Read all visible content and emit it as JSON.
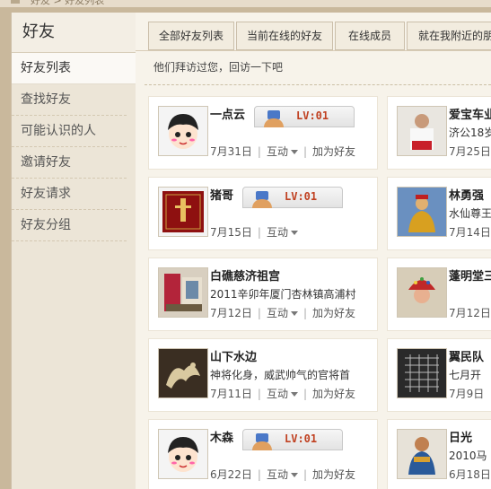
{
  "breadcrumb": "好友 > 好友列表",
  "sidebar": {
    "title": "好友",
    "items": [
      {
        "label": "好友列表",
        "active": true
      },
      {
        "label": "查找好友"
      },
      {
        "label": "可能认识的人"
      },
      {
        "label": "邀请好友"
      },
      {
        "label": "好友请求"
      },
      {
        "label": "好友分组"
      }
    ]
  },
  "tabs": [
    {
      "label": "全部好友列表"
    },
    {
      "label": "当前在线的好友"
    },
    {
      "label": "在线成员"
    },
    {
      "label": "就在我附近的朋友"
    }
  ],
  "notice": "他们拜访过您，回访一下吧",
  "interact_label": "互动",
  "add_friend_label": "加为好友",
  "badge_text": "LV:01",
  "left_cards": [
    {
      "name": "一点云",
      "signature": "",
      "date": "7月31日",
      "add": true,
      "badge": true
    },
    {
      "name": "猪哥",
      "signature": "",
      "date": "7月15日",
      "add": false,
      "badge": true
    },
    {
      "name": "白礁慈济祖宫",
      "signature": "2011辛卯年厦门杏林镇高浦村",
      "date": "7月12日",
      "add": true,
      "badge": false
    },
    {
      "name": "山下水边",
      "signature": "神将化身，威武帅气的官将首",
      "date": "7月11日",
      "add": true,
      "badge": false
    },
    {
      "name": "木森",
      "signature": "",
      "date": "6月22日",
      "add": true,
      "badge": true
    }
  ],
  "right_cards": [
    {
      "name": "爱宝车业",
      "signature": "济公18岁",
      "date": "7月25日"
    },
    {
      "name": "林勇强",
      "signature": "水仙尊王",
      "date": "7月14日"
    },
    {
      "name": "蓬明堂三",
      "signature": "",
      "date": "7月12日"
    },
    {
      "name": "翼民队",
      "signature": "七月开",
      "date": "7月9日"
    },
    {
      "name": "日光",
      "signature": "2010马",
      "date": "6月18日"
    }
  ]
}
